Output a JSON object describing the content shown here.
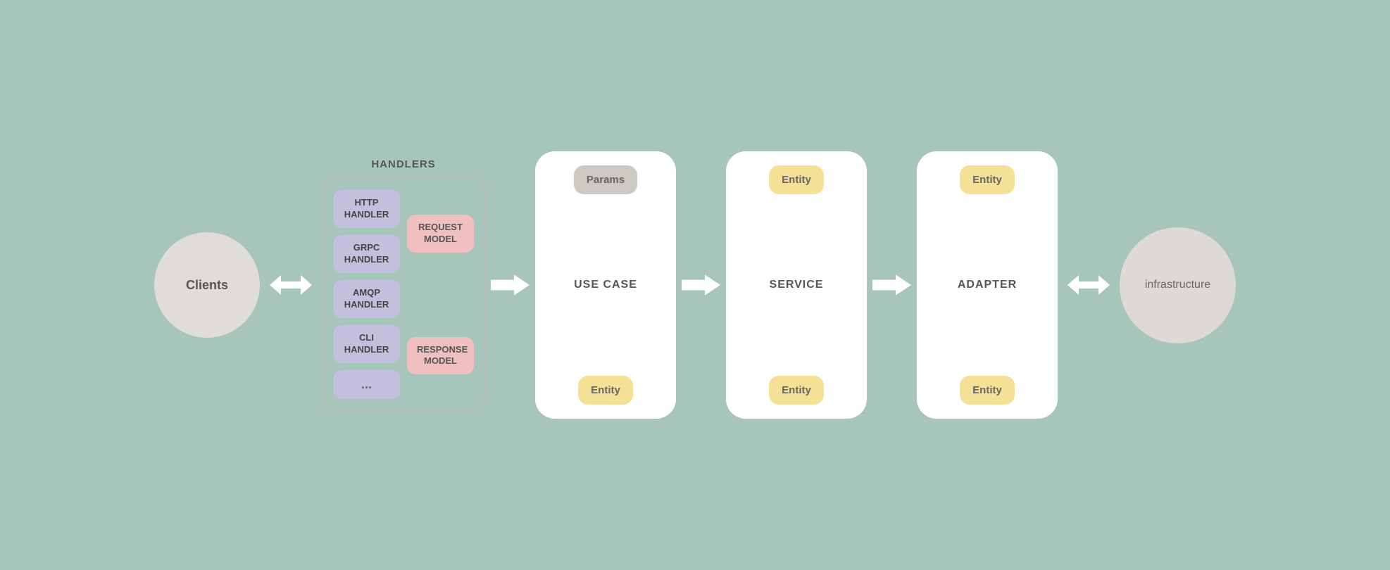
{
  "background_color": "#a8c5bc",
  "clients": {
    "label": "Clients"
  },
  "handlers": {
    "group_label": "HANDLERS",
    "buttons": [
      {
        "id": "http-handler",
        "label": "HTTP\nHANDLER",
        "type": "purple"
      },
      {
        "id": "grpc-handler",
        "label": "GRPC\nHANDLER",
        "type": "purple"
      },
      {
        "id": "amqp-handler",
        "label": "AMQP\nHANDLER",
        "type": "purple"
      },
      {
        "id": "cli-handler",
        "label": "CLI\nHANDLER",
        "type": "purple"
      },
      {
        "id": "more-handlers",
        "label": "...",
        "type": "dots"
      }
    ],
    "models": [
      {
        "id": "request-model",
        "label": "REQUEST\nMODEL",
        "type": "pink"
      },
      {
        "id": "response-model",
        "label": "RESPONSE\nMODEL",
        "type": "pink"
      }
    ]
  },
  "use_case": {
    "label": "USE CASE",
    "top_entity": "Params",
    "bottom_entity": "Entity"
  },
  "service": {
    "label": "SERVICE",
    "top_entity": "Entity",
    "bottom_entity": "Entity"
  },
  "adapter": {
    "label": "ADAPTER",
    "top_entity": "Entity",
    "bottom_entity": "Entity"
  },
  "infrastructure": {
    "label": "infrastructure"
  },
  "arrows": {
    "double_arrow": "⇔",
    "right_arrow": "→",
    "left_arrow": "←"
  }
}
